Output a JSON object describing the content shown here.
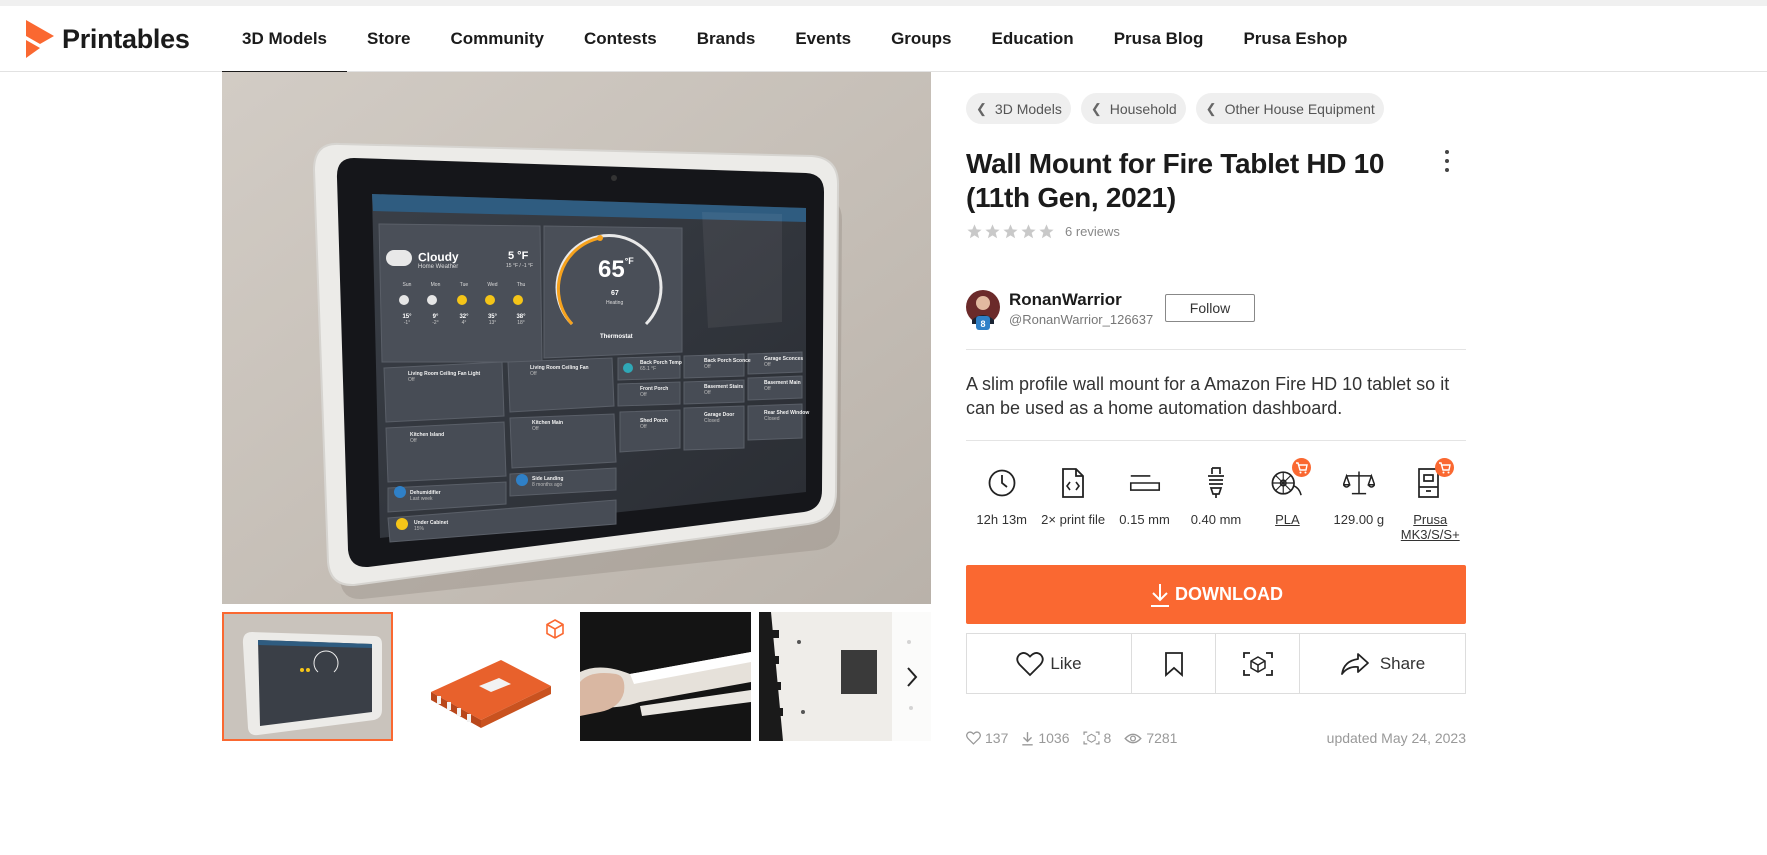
{
  "brand": {
    "name": "Printables",
    "accent": "#fa6831"
  },
  "nav": {
    "items": [
      "3D Models",
      "Store",
      "Community",
      "Contests",
      "Brands",
      "Events",
      "Groups",
      "Education",
      "Prusa Blog",
      "Prusa Eshop"
    ],
    "active": "3D Models"
  },
  "screen": {
    "weather": {
      "condition": "Cloudy",
      "subtitle": "Home Weather",
      "temp": "5 °F",
      "range": "15 °F / -1 °F"
    },
    "forecast": [
      {
        "day": "Sun",
        "hi": "15°",
        "lo": "-1°"
      },
      {
        "day": "Mon",
        "hi": "9°",
        "lo": "-2°"
      },
      {
        "day": "Tue",
        "hi": "32°",
        "lo": "4°"
      },
      {
        "day": "Wed",
        "hi": "35°",
        "lo": "13°"
      },
      {
        "day": "Thu",
        "hi": "38°",
        "lo": "18°"
      }
    ],
    "thermostat": {
      "setpoint": "65",
      "unit": "°F",
      "current": "67",
      "mode": "Heating",
      "name": "Thermostat"
    },
    "tiles": [
      "Living Room Ceiling Fan Light",
      "Living Room Ceiling Fan",
      "Back Porch Temp",
      "Back Porch Sconce",
      "Garage Sconces",
      "Kitchen Island",
      "Kitchen Main",
      "Front Porch",
      "Basement Stairs",
      "Basement Main",
      "Dehumidifier",
      "Side Landing",
      "Shed Porch",
      "Garage Door",
      "Rear Shed Window",
      "Under Cabinet"
    ],
    "tile_states": [
      "Off",
      "Off",
      "65.1 °F",
      "Off",
      "Off",
      "Off",
      "Off",
      "Off",
      "Off",
      "Off",
      "Last week",
      "8 months ago",
      "Off",
      "Closed",
      "Closed",
      "15%"
    ]
  },
  "breadcrumbs": [
    "3D Models",
    "Household",
    "Other House Equipment"
  ],
  "title": "Wall Mount for Fire Tablet HD 10 (11th Gen, 2021)",
  "rating": {
    "stars": 0,
    "reviews": "6 reviews"
  },
  "author": {
    "name": "RonanWarrior",
    "handle": "@RonanWarrior_126637",
    "follow_label": "Follow",
    "badge": "8"
  },
  "description": "A slim profile wall mount for a Amazon Fire HD 10 tablet so it can be used as a home automation dashboard.",
  "params": [
    {
      "icon": "clock-icon",
      "label": "12h 13m"
    },
    {
      "icon": "file-code-icon",
      "label": "2× print file"
    },
    {
      "icon": "layer-height-icon",
      "label": "0.15 mm"
    },
    {
      "icon": "nozzle-icon",
      "label": "0.40 mm"
    },
    {
      "icon": "filament-spool-icon",
      "label": "PLA"
    },
    {
      "icon": "scale-icon",
      "label": "129.00 g"
    },
    {
      "icon": "printer-icon",
      "label": "Prusa MK3/S/S+"
    }
  ],
  "download_label": "DOWNLOAD",
  "actions": {
    "like": "Like",
    "share": "Share"
  },
  "stats": {
    "likes": "137",
    "downloads": "1036",
    "makes": "8",
    "views": "7281",
    "updated": "updated May 24, 2023"
  }
}
